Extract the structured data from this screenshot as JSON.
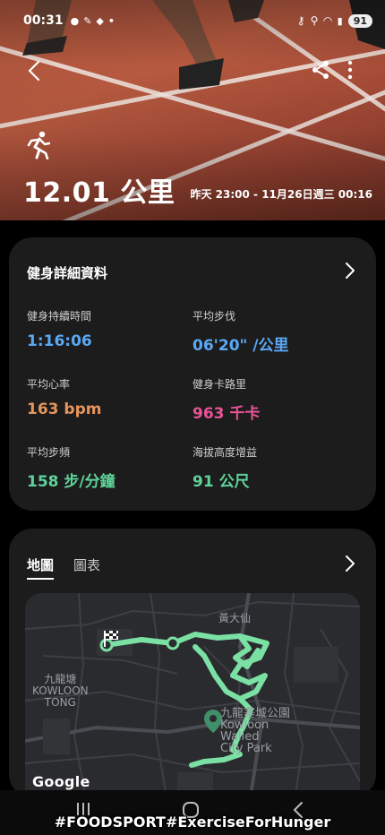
{
  "status_bar": {
    "time": "00:31",
    "battery": "91"
  },
  "hero": {
    "distance": "12.01 公里",
    "time_span": "昨天 23:00 - 11月26日週三 00:16"
  },
  "details": {
    "title": "健身詳細資料",
    "metrics": [
      {
        "label": "健身持續時間",
        "value": "1:16:06",
        "color": "#5aa9f5"
      },
      {
        "label": "平均步伐",
        "value": "06'20\" /公里",
        "color": "#5aa9f5"
      },
      {
        "label": "平均心率",
        "value": "163 bpm",
        "color": "#e6955a"
      },
      {
        "label": "健身卡路里",
        "value": "963 千卡",
        "color": "#e85497"
      },
      {
        "label": "平均步頻",
        "value": "158 步/分鐘",
        "color": "#5fd39a"
      },
      {
        "label": "海拔高度增益",
        "value": "91 公尺",
        "color": "#5fd39a"
      }
    ]
  },
  "map_card": {
    "tabs": [
      "地圖",
      "圖表"
    ],
    "active_tab": "地圖",
    "map_labels": {
      "wong_tai_sin": "黃大仙",
      "kowloon_tong_zh": "九龍塘",
      "kowloon_tong_en1": "KOWLOON",
      "kowloon_tong_en2": "TONG",
      "park_zh": "九龍寨城公園",
      "park_en1": "Kowloon",
      "park_en2": "Walled",
      "park_en3": "City Park"
    },
    "attribution": "Google",
    "route_color": "#7be0a4"
  },
  "overlay_text": "#FOODSPORT#ExerciseForHunger"
}
